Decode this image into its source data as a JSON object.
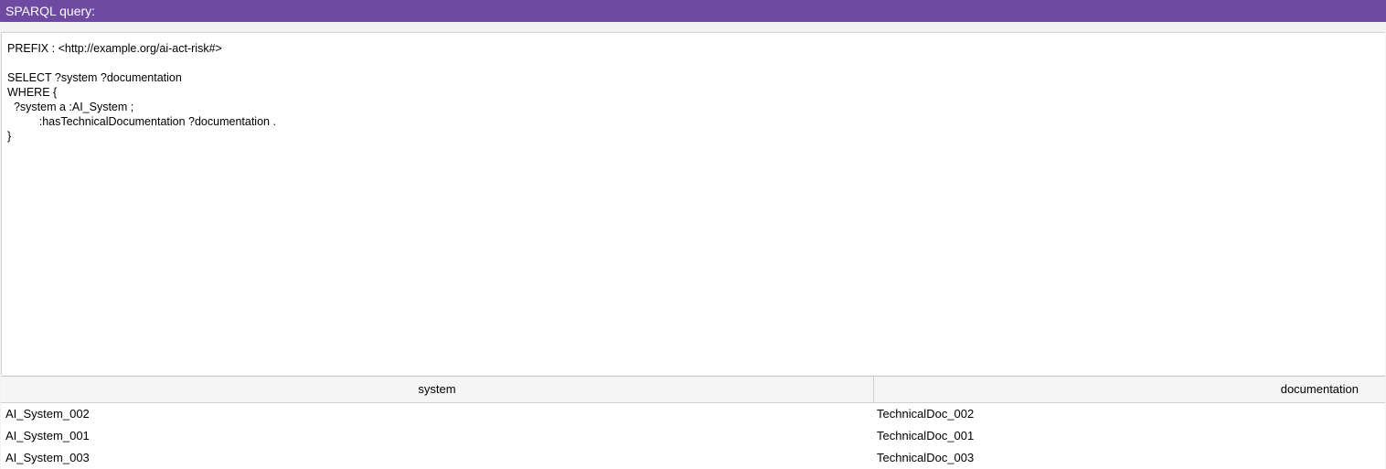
{
  "panel": {
    "title": "SPARQL query:"
  },
  "editor": {
    "lines": [
      "PREFIX : <http://example.org/ai-act-risk#>",
      "",
      "SELECT ?system ?documentation",
      "WHERE {",
      "  ?system a :AI_System ;",
      "          :hasTechnicalDocumentation ?documentation .",
      "}"
    ]
  },
  "results": {
    "columns": [
      "system",
      "documentation"
    ],
    "rows": [
      [
        "AI_System_002",
        "TechnicalDoc_002"
      ],
      [
        "AI_System_001",
        "TechnicalDoc_001"
      ],
      [
        "AI_System_003",
        "TechnicalDoc_003"
      ]
    ]
  },
  "colors": {
    "title_bar": "#6f4aa3",
    "title_text": "#ffffff"
  }
}
